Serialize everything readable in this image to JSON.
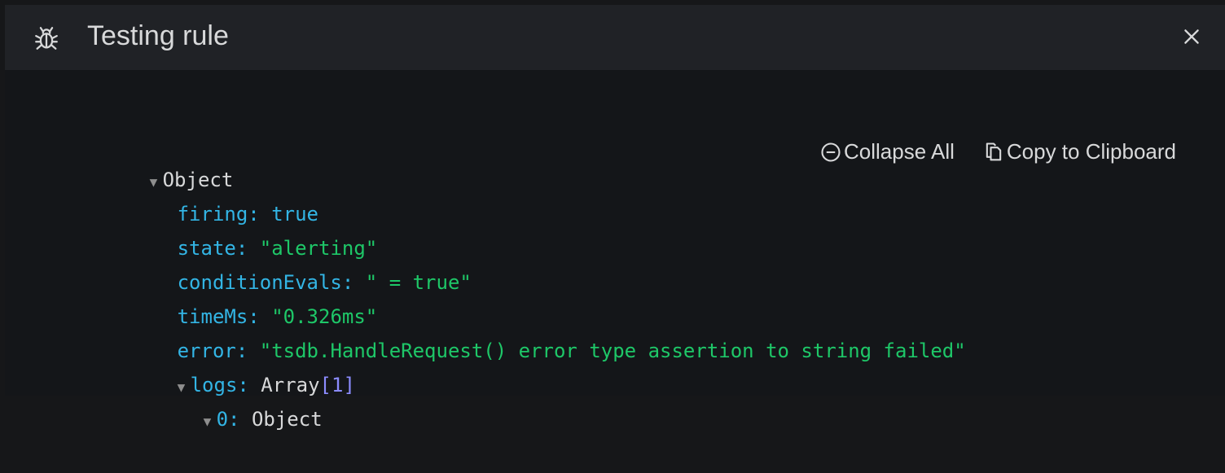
{
  "header": {
    "title": "Testing rule",
    "icon": "bug-icon",
    "close_icon": "close-icon"
  },
  "toolbar": {
    "collapse_label": "Collapse All",
    "copy_label": "Copy to Clipboard"
  },
  "tree": {
    "root_label": "Object",
    "firing": {
      "key": "firing",
      "value": "true"
    },
    "state": {
      "key": "state",
      "value": "\"alerting\""
    },
    "conditionEvals": {
      "key": "conditionEvals",
      "value": "\" = true\""
    },
    "timeMs": {
      "key": "timeMs",
      "value": "\"0.326ms\""
    },
    "error": {
      "key": "error",
      "value": "\"tsdb.HandleRequest() error type assertion to string failed\""
    },
    "logs": {
      "key": "logs",
      "type": "Array",
      "count": "1"
    },
    "log0": {
      "key": "0",
      "type": "Object"
    }
  },
  "colors": {
    "key": "#33b5e5",
    "string": "#1ec768",
    "text": "#d8d9da",
    "header_bg": "#202226",
    "body_bg": "#141619"
  }
}
